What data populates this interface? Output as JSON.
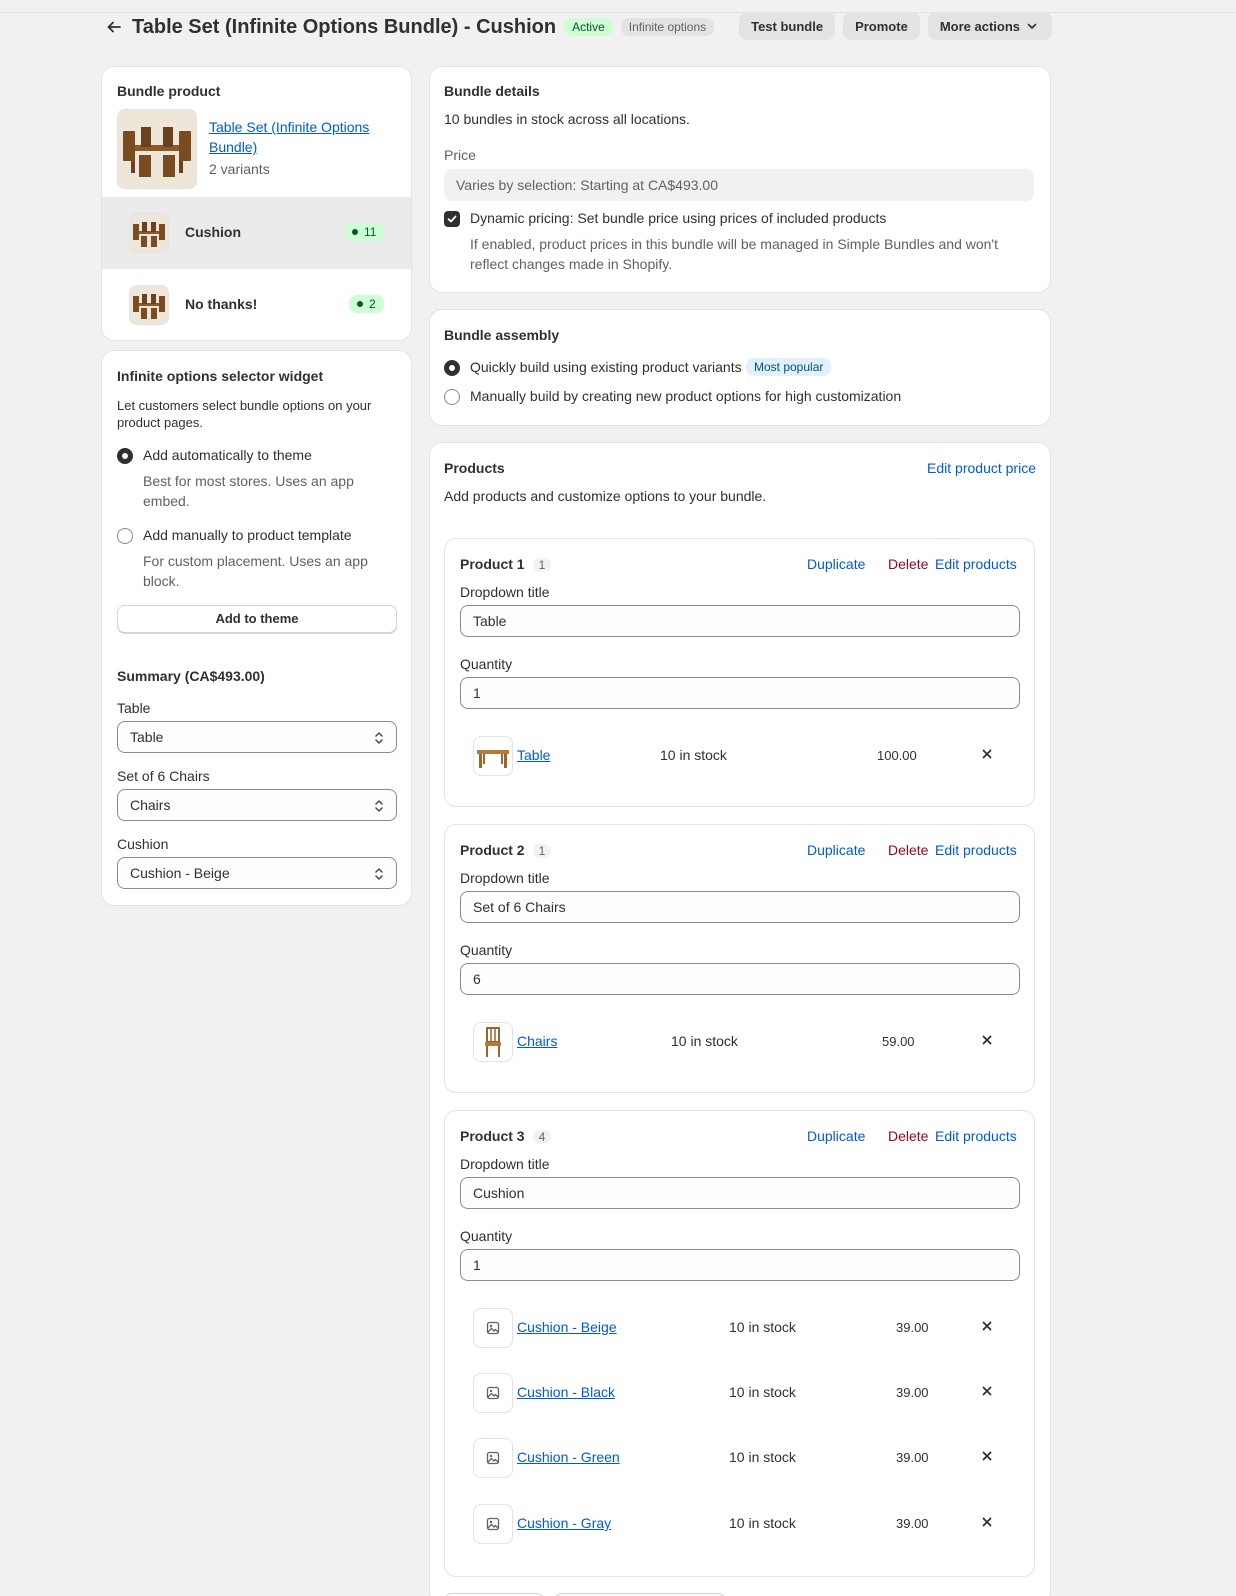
{
  "header": {
    "title": "Table Set (Infinite Options Bundle) - Cushion",
    "status_badge": "Active",
    "type_badge": "Infinite options",
    "test_bundle_label": "Test bundle",
    "promote_label": "Promote",
    "more_actions_label": "More actions"
  },
  "bundle_product": {
    "heading": "Bundle product",
    "product_link": "Table Set (Infinite Options Bundle)",
    "variants_text": "2 variants",
    "variants": [
      {
        "label": "Cushion",
        "stock": "11"
      },
      {
        "label": "No thanks!",
        "stock": "2"
      }
    ]
  },
  "widget": {
    "heading": "Infinite options selector widget",
    "description": "Let customers select bundle options on your product pages.",
    "option_auto_label": "Add automatically to theme",
    "option_auto_help": "Best for most stores. Uses an app embed.",
    "option_manual_label": "Add manually to product template",
    "option_manual_help": "For custom placement. Uses an app block.",
    "add_button_label": "Add to theme",
    "summary_heading": "Summary (CA$493.00)",
    "selects": [
      {
        "label": "Table",
        "value": "Table"
      },
      {
        "label": "Set of 6 Chairs",
        "value": "Chairs"
      },
      {
        "label": "Cushion",
        "value": "Cushion - Beige"
      }
    ]
  },
  "bundle_details": {
    "heading": "Bundle details",
    "stock_text": "10 bundles in stock across all locations.",
    "price_label": "Price",
    "price_value": "Varies by selection: Starting at CA$493.00",
    "dynamic_label": "Dynamic pricing: Set bundle price using prices of included products",
    "dynamic_help": "If enabled, product prices in this bundle will be managed in Simple Bundles and won't reflect changes made in Shopify.",
    "dynamic_checked": true
  },
  "bundle_assembly": {
    "heading": "Bundle assembly",
    "option_quick_label": "Quickly build using existing product variants",
    "option_quick_badge": "Most popular",
    "option_manual_label": "Manually build by creating new product options for high customization"
  },
  "products": {
    "heading": "Products",
    "edit_price_label": "Edit product price",
    "description": "Add products and customize options to your bundle.",
    "duplicate_label": "Duplicate",
    "delete_label": "Delete",
    "edit_products_label": "Edit products",
    "dropdown_title_label": "Dropdown title",
    "quantity_label": "Quantity",
    "groups": [
      {
        "title": "Product 1",
        "count": "1",
        "dropdown_title": "Table",
        "quantity": "1",
        "items": [
          {
            "name": "Table",
            "stock": "10 in stock",
            "price": "100.00",
            "thumb": "table"
          }
        ]
      },
      {
        "title": "Product 2",
        "count": "1",
        "dropdown_title": "Set of 6 Chairs",
        "quantity": "6",
        "items": [
          {
            "name": "Chairs",
            "stock": "10 in stock",
            "price": "59.00",
            "thumb": "chair"
          }
        ]
      },
      {
        "title": "Product 3",
        "count": "4",
        "dropdown_title": "Cushion",
        "quantity": "1",
        "items": [
          {
            "name": "Cushion - Beige",
            "stock": "10 in stock",
            "price": "39.00",
            "thumb": "image-placeholder"
          },
          {
            "name": "Cushion - Black",
            "stock": "10 in stock",
            "price": "39.00",
            "thumb": "image-placeholder"
          },
          {
            "name": "Cushion - Green",
            "stock": "10 in stock",
            "price": "39.00",
            "thumb": "image-placeholder"
          },
          {
            "name": "Cushion - Gray",
            "stock": "10 in stock",
            "price": "39.00",
            "thumb": "image-placeholder"
          }
        ]
      }
    ]
  },
  "colors": {
    "link": "#005bd3",
    "danger": "#8e0b21",
    "success_bg": "#cdfed4",
    "page_bg": "#f1f1f1"
  }
}
